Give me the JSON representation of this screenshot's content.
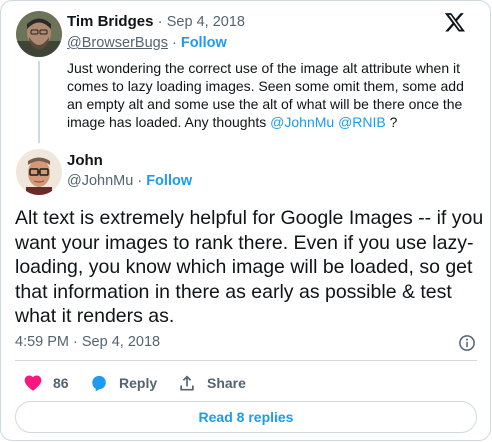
{
  "quoted": {
    "author_name": "Tim Bridges",
    "date": "Sep 4, 2018",
    "handle": "@BrowserBugs",
    "follow": "Follow",
    "text_main": "Just wondering the correct use of the image alt attribute when it comes to lazy loading images. Seen some omit them, some add an empty alt and some use the alt of what will be there once the image has loaded. Any thoughts ",
    "mention1": "@JohnMu",
    "mention2": "@RNIB",
    "text_end": " ?"
  },
  "reply": {
    "author_name": "John",
    "handle": "@JohnMu",
    "follow": "Follow",
    "text": "Alt text is extremely helpful for Google Images -- if you want your images to rank there. Even if you use lazy-loading, you know which image will be loaded, so get that information in there as early as possible & test what it renders as.",
    "timestamp": "4:59 PM · Sep 4, 2018"
  },
  "actions": {
    "likes": "86",
    "reply": "Reply",
    "share": "Share"
  },
  "read_replies": "Read 8 replies",
  "icons": [
    "x-logo-icon",
    "heart-icon",
    "reply-bubble-icon",
    "share-icon",
    "info-icon"
  ],
  "colors": {
    "accent": "#1d9bf0",
    "like": "#f91880",
    "muted": "#536471",
    "border": "#cfd9de"
  }
}
